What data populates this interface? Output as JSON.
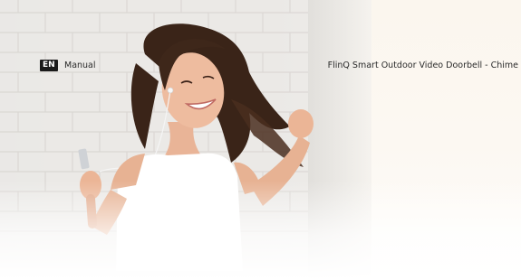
{
  "header": {
    "language_badge": "EN",
    "document_type": "Manual",
    "product_title": "FlinQ Smart Outdoor Video Doorbell - Chime"
  },
  "cover_image": {
    "subject": "woman-with-earphones-dancing",
    "background": "white-brick-wall"
  }
}
